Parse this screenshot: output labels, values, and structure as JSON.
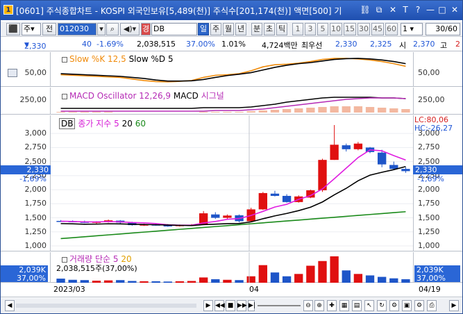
{
  "window": {
    "number": "1",
    "title": "[0601] 주식종합차트 - KOSPI 외국인보유[5,489(천)] 주식수[201,174(천)] 액면[500] 기"
  },
  "toolbar": {
    "type_select": "주",
    "item_label": "전",
    "code": "012030",
    "name": "DB",
    "tag_label": "경",
    "periods": [
      "일",
      "주",
      "월",
      "년",
      "분",
      "초",
      "틱"
    ],
    "active_period": "일",
    "intervals": [
      "1",
      "3",
      "5",
      "10",
      "15",
      "30",
      "45",
      "60"
    ],
    "count_select": "1",
    "page": "30/60"
  },
  "quote": {
    "price": "2,330",
    "change": "40",
    "change_pct": "-1.69%",
    "volume": "2,038,515",
    "vol_pct": "37.00%",
    "turnover": "1.01%",
    "amount": "4,724백만",
    "best_label": "최우선",
    "ask": "2,330",
    "bid": "2,325",
    "open_label": "시",
    "open": "2,370",
    "high_label": "고",
    "high": "2"
  },
  "panels": {
    "stoch": {
      "legend1": "Slow %K 12,5",
      "legend2": "Slow %D 5",
      "tick": "50,00",
      "right_tick": "50,00"
    },
    "macd": {
      "legend1": "MACD Oscillator 12,26,9",
      "legend2": "MACD",
      "legend3": "시그널",
      "tick": "250,00",
      "right_tick": "250,00"
    },
    "price": {
      "legend_box": "DB",
      "legend1": "종가 지수 5",
      "legend2": "20",
      "legend3": "60",
      "lc": "LC:80,06",
      "hc": "HC:-26,27",
      "ticks": [
        "3,000",
        "2,750",
        "2,500",
        "2,250",
        "2,000",
        "1,750",
        "1,500",
        "1,250",
        "1,000"
      ],
      "current": "2,330",
      "current_pct": "-1,69%"
    },
    "volume": {
      "legend1": "거래량",
      "legend2": "단순 5",
      "legend3": "20",
      "value": "2,038,515주(37,00%)",
      "tag": "2,039K",
      "tag_pct": "37,00%"
    }
  },
  "dates": {
    "start": "2023/03",
    "mid": "04",
    "end": "04/19"
  },
  "chart_data": {
    "type": "candlestick",
    "ylim": [
      1000,
      3150
    ],
    "candles": [
      {
        "o": 1445,
        "h": 1460,
        "l": 1430,
        "c": 1440
      },
      {
        "o": 1440,
        "h": 1455,
        "l": 1420,
        "c": 1430
      },
      {
        "o": 1435,
        "h": 1450,
        "l": 1405,
        "c": 1410
      },
      {
        "o": 1410,
        "h": 1440,
        "l": 1395,
        "c": 1430
      },
      {
        "o": 1430,
        "h": 1470,
        "l": 1415,
        "c": 1455
      },
      {
        "o": 1450,
        "h": 1460,
        "l": 1400,
        "c": 1415
      },
      {
        "o": 1410,
        "h": 1430,
        "l": 1360,
        "c": 1370
      },
      {
        "o": 1370,
        "h": 1395,
        "l": 1355,
        "c": 1380
      },
      {
        "o": 1380,
        "h": 1400,
        "l": 1360,
        "c": 1370
      },
      {
        "o": 1365,
        "h": 1390,
        "l": 1340,
        "c": 1350
      },
      {
        "o": 1355,
        "h": 1380,
        "l": 1345,
        "c": 1370
      },
      {
        "o": 1370,
        "h": 1390,
        "l": 1355,
        "c": 1375
      },
      {
        "o": 1375,
        "h": 1620,
        "l": 1370,
        "c": 1580
      },
      {
        "o": 1560,
        "h": 1600,
        "l": 1480,
        "c": 1500
      },
      {
        "o": 1500,
        "h": 1560,
        "l": 1480,
        "c": 1540
      },
      {
        "o": 1545,
        "h": 1560,
        "l": 1420,
        "c": 1440
      },
      {
        "o": 1440,
        "h": 1680,
        "l": 1430,
        "c": 1650
      },
      {
        "o": 1650,
        "h": 1960,
        "l": 1640,
        "c": 1940
      },
      {
        "o": 1930,
        "h": 1980,
        "l": 1880,
        "c": 1890
      },
      {
        "o": 1890,
        "h": 1920,
        "l": 1770,
        "c": 1780
      },
      {
        "o": 1780,
        "h": 1900,
        "l": 1770,
        "c": 1880
      },
      {
        "o": 1860,
        "h": 2000,
        "l": 1850,
        "c": 1990
      },
      {
        "o": 1990,
        "h": 2550,
        "l": 1960,
        "c": 2530
      },
      {
        "o": 2530,
        "h": 3150,
        "l": 2530,
        "c": 2800
      },
      {
        "o": 2790,
        "h": 2820,
        "l": 2680,
        "c": 2720
      },
      {
        "o": 2720,
        "h": 2850,
        "l": 2700,
        "c": 2820
      },
      {
        "o": 2750,
        "h": 2760,
        "l": 2650,
        "c": 2670
      },
      {
        "o": 2660,
        "h": 2710,
        "l": 2400,
        "c": 2450
      },
      {
        "o": 2440,
        "h": 2500,
        "l": 2350,
        "c": 2370
      },
      {
        "o": 2370,
        "h": 2400,
        "l": 2300,
        "c": 2330
      }
    ],
    "volumes": [
      14,
      10,
      9,
      7,
      8,
      9,
      6,
      5,
      5,
      4,
      5,
      6,
      18,
      12,
      10,
      9,
      22,
      60,
      35,
      22,
      30,
      58,
      74,
      90,
      42,
      30,
      25,
      20,
      15,
      12
    ]
  }
}
